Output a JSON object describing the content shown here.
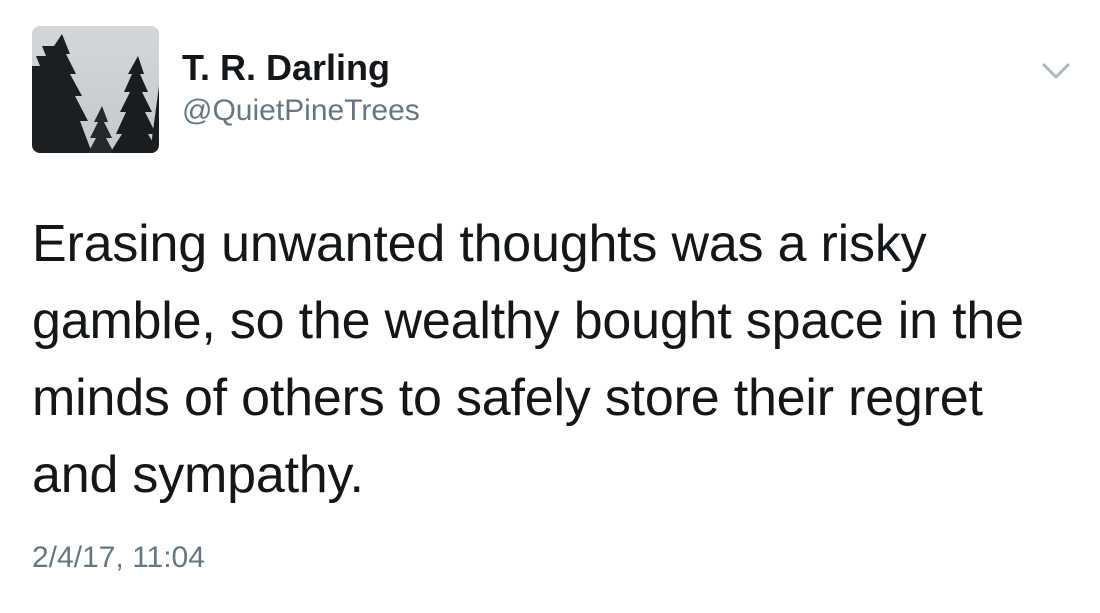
{
  "tweet": {
    "author": {
      "display_name": "T. R. Darling",
      "handle": "@QuietPineTrees",
      "avatar_icon": "pine-trees-avatar"
    },
    "menu_icon": "chevron-down-icon",
    "text": "Erasing unwanted thoughts was a risky\ngamble, so the wealthy bought space in the\nminds of others to safely store their regret\nand sympathy.",
    "timestamp": "2/4/17, 11:04"
  },
  "colors": {
    "primary_text": "#14171a",
    "secondary_text": "#657786",
    "caret": "#aab8c2",
    "background": "#ffffff"
  }
}
